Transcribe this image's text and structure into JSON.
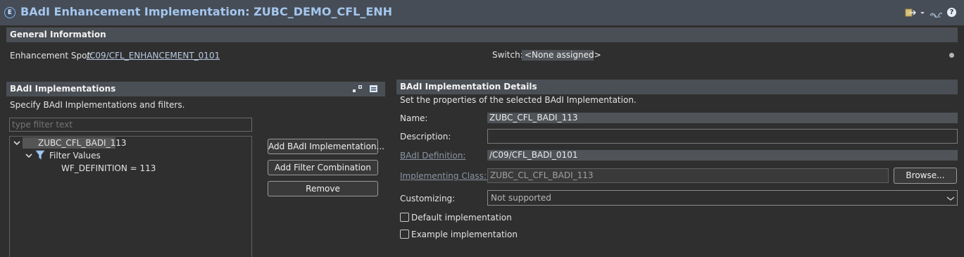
{
  "header": {
    "title": "BAdI Enhancement Implementation: ZUBC_DEMO_CFL_ENH",
    "icon_letter": "E",
    "help_glyph": "?"
  },
  "general": {
    "section_title": "General Information",
    "spot_label": "Enhancement Spot:",
    "spot_value": "/C09/CFL_ENHANCEMENT_0101",
    "switch_label": "Switch:",
    "switch_value": "<None assigned>"
  },
  "impls": {
    "section_title": "BAdI Implementations",
    "description": "Specify BAdI Implementations and filters.",
    "filter_placeholder": "type filter text",
    "tree": {
      "root": "ZUBC_CFL_BADI_113",
      "filter_node": "Filter Values",
      "filter_value": "WF_DEFINITION = 113"
    },
    "buttons": {
      "add_impl": "Add BAdI Implementation...",
      "add_filter": "Add Filter Combination",
      "remove": "Remove"
    }
  },
  "details": {
    "section_title": "BAdI Implementation Details",
    "description": "Set the properties of the selected BAdI Implementation.",
    "name_label": "Name:",
    "name_value": "ZUBC_CFL_BADI_113",
    "description_label": "Description:",
    "description_value": "",
    "badi_def_label": "BAdI Definition:",
    "badi_def_value": "/C09/CFL_BADI_0101",
    "impl_class_label": "Implementing Class: *",
    "impl_class_value": "ZUBC_CL_CFL_BADI_113",
    "browse_label": "Browse...",
    "customizing_label": "Customizing:",
    "customizing_value": "Not supported",
    "default_impl_label": "Default implementation",
    "default_impl_checked": false,
    "example_impl_label": "Example implementation",
    "example_impl_checked": false
  }
}
